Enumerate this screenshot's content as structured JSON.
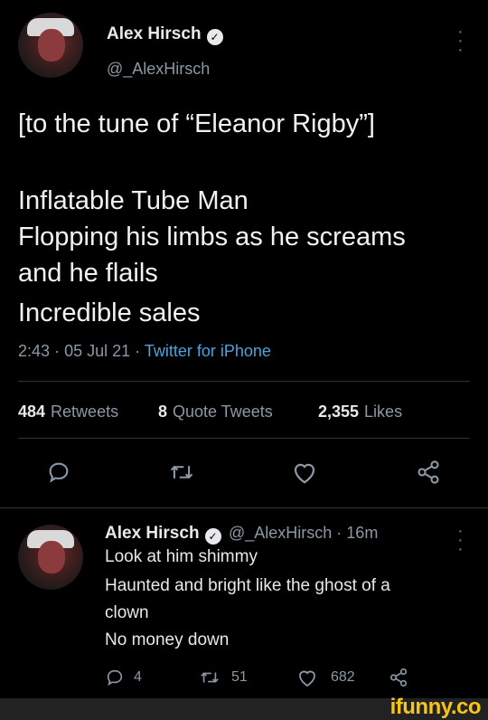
{
  "main_tweet": {
    "author_name": "Alex Hirsch",
    "handle": "@_AlexHirsch",
    "lines": [
      "[to the tune of “Eleanor Rigby”]",
      "Inflatable Tube Man",
      "Flopping his limbs as he screams",
      "and he flails",
      "Incredible sales"
    ],
    "time": "2:43",
    "date": "05 Jul 21",
    "source": "Twitter for iPhone",
    "stats": {
      "retweets_count": "484",
      "retweets_label": "Retweets",
      "quotes_count": "8",
      "quotes_label": "Quote Tweets",
      "likes_count": "2,355",
      "likes_label": "Likes"
    }
  },
  "reply_tweet": {
    "author_name": "Alex Hirsch",
    "handle_time": "@_AlexHirsch · 16m",
    "lines": [
      "Look at him shimmy",
      "Haunted and bright like the ghost of a",
      "clown",
      "No money down"
    ],
    "reply_count": "4",
    "retweet_count": "51",
    "like_count": "682"
  },
  "watermark": "ifunny.co",
  "separator": "·",
  "icons": {
    "verified": "verified-badge-icon",
    "more": "more-vertical-icon",
    "reply": "reply-icon",
    "retweet": "retweet-icon",
    "like": "heart-icon",
    "share": "share-icon"
  },
  "colors": {
    "background": "#000000",
    "text": "#e7e9ea",
    "muted": "#8b98a5",
    "link": "#4aa3df",
    "watermark": "#f5c518"
  }
}
